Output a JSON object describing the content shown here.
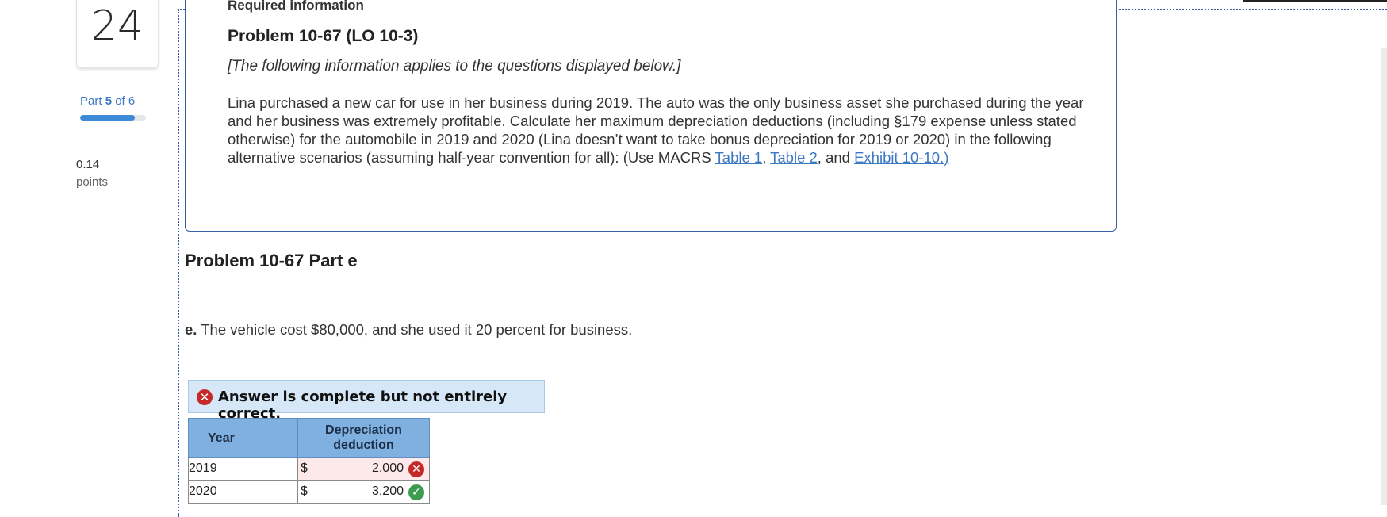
{
  "sidebar": {
    "question_number": "24",
    "part_word": "Part",
    "part_current": "5",
    "part_of": "of 6",
    "progress_fraction": 0.833,
    "points_value": "0.14",
    "points_label": "points"
  },
  "info_box": {
    "heading": "Required information",
    "problem_title": "Problem 10-67 (LO 10-3)",
    "note": "[The following information applies to the questions displayed below.]",
    "body_text": "Lina purchased a new car for use in her business during 2019. The auto was the only business asset she purchased during the year and her business was extremely profitable. Calculate her maximum depreciation deductions (including §179 expense unless stated otherwise) for the automobile in 2019 and 2020 (Lina doesn’t want to take bonus depreciation for 2019 or 2020) in the following alternative scenarios (assuming half-year convention for all): (Use MACRS ",
    "link_table1": "Table 1",
    "sep1": ", ",
    "link_table2": "Table 2",
    "sep2": ", and ",
    "link_exhibit": "Exhibit 10-10.",
    "close_paren": ")"
  },
  "part_title": "Problem 10-67 Part e",
  "question": {
    "letter": "e.",
    "text": " The vehicle cost $80,000, and she used it 20 percent for business."
  },
  "banner": {
    "icon": "error-x-icon",
    "text": "Answer is complete but not entirely correct."
  },
  "table": {
    "headers": {
      "year": "Year",
      "deduction": "Depreciation deduction"
    },
    "rows": [
      {
        "year": "2019",
        "currency": "$",
        "value": "2,000",
        "status": "incorrect"
      },
      {
        "year": "2020",
        "currency": "$",
        "value": "3,200",
        "status": "correct"
      }
    ]
  },
  "colors": {
    "accent_blue": "#3b78c2",
    "table_header": "#7fb0e0",
    "banner_bg": "#d6e8f7",
    "incorrect_red": "#c62828",
    "correct_green": "#3e9b4f"
  }
}
